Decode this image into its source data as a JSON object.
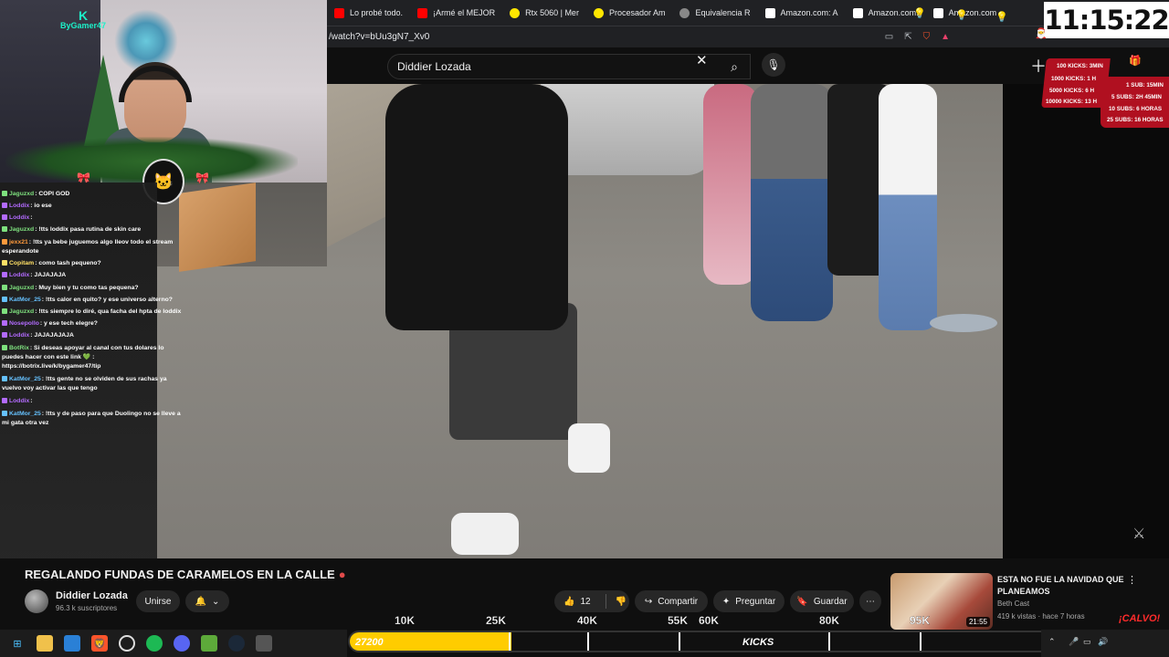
{
  "browser": {
    "bookmarks": [
      {
        "label": "Lo probé todo.",
        "color": "#ff0000"
      },
      {
        "label": "¡Armé el MEJOR",
        "color": "#ff0000"
      },
      {
        "label": "Rtx 5060 | Mer",
        "color": "#ffe600"
      },
      {
        "label": "Procesador Am",
        "color": "#ffe600"
      },
      {
        "label": "Equivalencia R",
        "color": "#e8eaed"
      },
      {
        "label": "Amazon.com: A",
        "color": "#ffffff"
      },
      {
        "label": "Amazon.com:",
        "color": "#ffffff"
      },
      {
        "label": "Amazon.com",
        "color": "#ffffff"
      }
    ],
    "url": "/watch?v=bUu3gN7_Xv0"
  },
  "youtube": {
    "search_query": "Diddier Lozada",
    "video_title": "REGALANDO FUNDAS DE CARAMELOS EN LA CALLE",
    "channel_name": "Diddier Lozada",
    "channel_subs": "96.3 k suscriptores",
    "join_label": "Unirse",
    "like_count": "12",
    "share_label": "Compartir",
    "ask_label": "Preguntar",
    "save_label": "Guardar",
    "recommended": {
      "title": "ESTA NO FUE LA NAVIDAD QUE PLANEAMOS",
      "channel": "Beth Cast",
      "meta": "419 k vistas · hace 7 horas",
      "duration": "21:55"
    }
  },
  "stream": {
    "clock": "11:15:22",
    "watermark": "ByGamer47",
    "goals_left": [
      "100 KICKS: 3MIN",
      "1000 KICKS: 1 H",
      "5000 KICKS: 6 H",
      "10000 KICKS: 13 H"
    ],
    "goals_right": [
      "1 SUB: 15MIN",
      "5 SUBS: 2H 45MIN",
      "10 SUBS: 6 HORAS",
      "25 SUBS: 16 HORAS"
    ],
    "kick_goal_labels": [
      "10K",
      "25K",
      "40K",
      "55K",
      "60K",
      "80K",
      "95K"
    ],
    "kick_current": "27200",
    "kick_bar_label": "KICKS",
    "kick_max": "135000",
    "kick_progress": 0.2015,
    "calvo": "¡CALVO!",
    "bar_accent": "#ffcc00"
  },
  "chat": [
    {
      "user": "Jaguzxd",
      "text": ": COPI GOD",
      "color": "#7ee07e"
    },
    {
      "user": "Loddix",
      "text": ": io ese",
      "color": "#b36bff"
    },
    {
      "user": "Loddix",
      "text": ": ",
      "color": "#b36bff"
    },
    {
      "user": "Jaguzxd",
      "text": ": !tts loddix pasa rutina de skin care",
      "color": "#7ee07e"
    },
    {
      "user": "jexx21",
      "text": ": !tts ya bebe juguemos algo lleov todo el stream esperandote",
      "color": "#ff9a3c"
    },
    {
      "user": "Copitam",
      "text": ": como tash pequeno?",
      "color": "#ffe066"
    },
    {
      "user": "Loddix",
      "text": ": JAJAJAJA",
      "color": "#b36bff"
    },
    {
      "user": "Jaguzxd",
      "text": ": Muy bien y tu como tas pequena?",
      "color": "#7ee07e"
    },
    {
      "user": "KatMor_25",
      "text": ": !tts calor en quito? y ese universo alterno?",
      "color": "#66c2ff"
    },
    {
      "user": "Jaguzxd",
      "text": ": !tts siempre lo diré, qua facha del hpta de loddix",
      "color": "#7ee07e"
    },
    {
      "user": "Nosepollo",
      "text": ": y ese tech elegre?",
      "color": "#b36bff"
    },
    {
      "user": "Loddix",
      "text": ": JAJAJAJAJA",
      "color": "#b36bff"
    },
    {
      "user": "BotRix",
      "text": ": Si deseas apoyar al canal con tus dolares lo puedes hacer con este link 💚 : https://botrix.live/k/bygamer47/tip",
      "color": "#7ee07e"
    },
    {
      "user": "KatMor_25",
      "text": ": !tts gente no se olviden de sus rachas ya vuelvo voy activar las que tengo",
      "color": "#66c2ff"
    },
    {
      "user": "Loddix",
      "text": ": ",
      "color": "#b36bff"
    },
    {
      "user": "KatMor_25",
      "text": ": !tts y de paso para que Duolingo no se lleve a mi gata otra vez",
      "color": "#66c2ff"
    }
  ]
}
